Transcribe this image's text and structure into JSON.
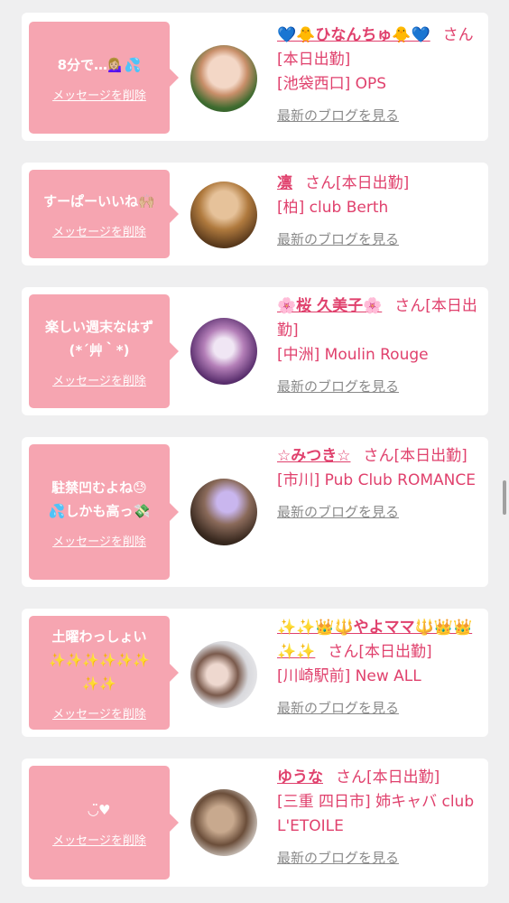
{
  "common": {
    "delete_label": "メッセージを削除",
    "blog_label": "最新のブログを見る",
    "suffix": "さん[本日出勤]"
  },
  "colors": {
    "accent": "#e0416d",
    "bubble": "#f6a5b1",
    "background": "#efeff0"
  },
  "cards": [
    {
      "message": "8分で…💁🏼‍♀️💦",
      "name": "💙🐥ひなんちゅ🐥💙",
      "shop": "[池袋西口] OPS"
    },
    {
      "message": "すーぱーいいね🙌🏼",
      "name": "凛",
      "shop": "[柏] club Berth"
    },
    {
      "message": "楽しい週末なはず\n(*´艸｀*)",
      "name": "🌸桜 久美子🌸",
      "shop": "[中洲] Moulin Rouge"
    },
    {
      "message": "駐禁凹むよね😓\n💦しかも高っ💸",
      "name": "☆みつき☆",
      "shop": "[市川] Pub Club ROMANCE"
    },
    {
      "message": "土曜わっしょい\n✨✨✨✨✨✨\n✨✨",
      "name": "✨✨👑🔱やよママ🔱👑👑✨✨",
      "shop": "[川崎駅前] New ALL"
    },
    {
      "message": "◡̈♥︎",
      "name": "ゆうな",
      "shop": "[三重 四日市] 姉キャバ club L'ETOILE"
    }
  ]
}
